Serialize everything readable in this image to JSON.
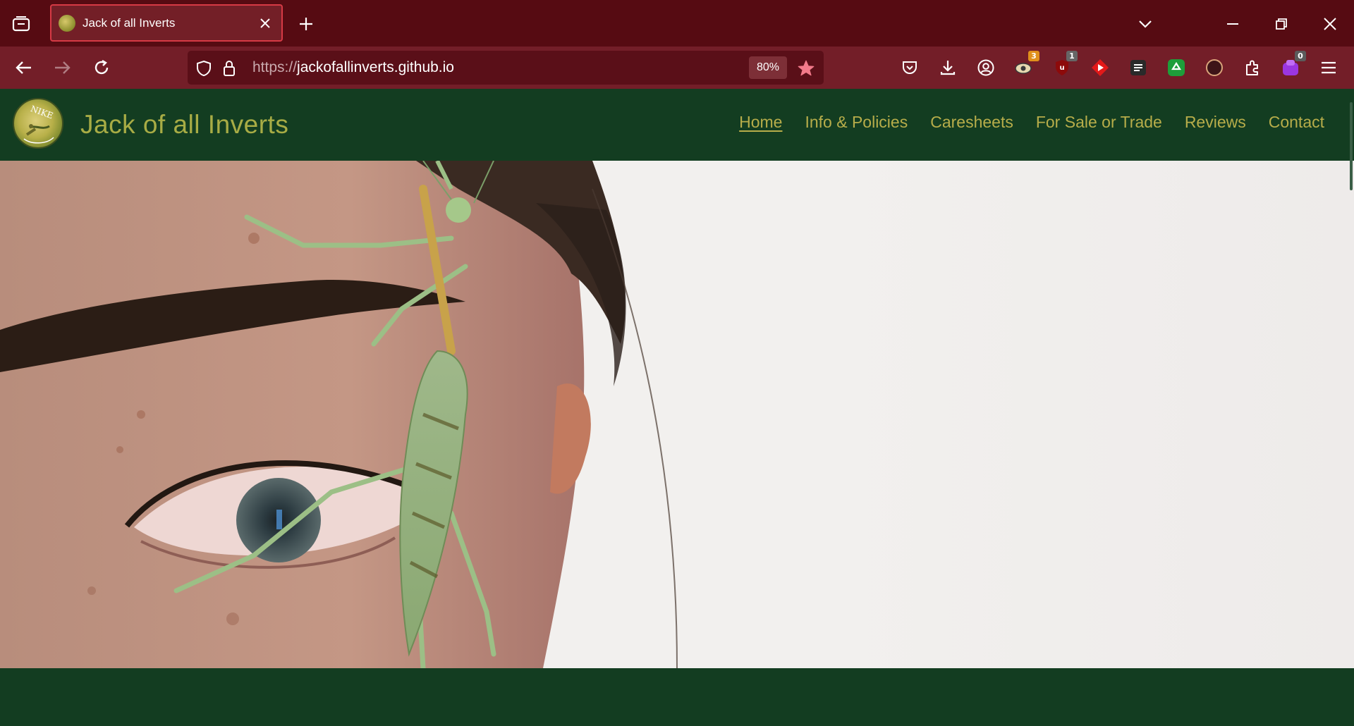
{
  "browser": {
    "tab": {
      "title": "Jack of all Inverts"
    },
    "url": {
      "scheme": "https://",
      "host": "jackofallinverts.github.io"
    },
    "zoom": "80%",
    "extension_badges": {
      "ext1": "3",
      "ublock": "1",
      "ext_purple": "0"
    }
  },
  "site": {
    "title": "Jack of all Inverts",
    "logo_text": "NIKE",
    "nav": [
      {
        "label": "Home",
        "active": true
      },
      {
        "label": "Info & Policies"
      },
      {
        "label": "Caresheets"
      },
      {
        "label": "For Sale or Trade"
      },
      {
        "label": "Reviews"
      },
      {
        "label": "Contact"
      }
    ]
  },
  "colors": {
    "tabbar": "#560b12",
    "navbar": "#731e28",
    "site_header": "#133d21",
    "site_text": "#b7ad4a"
  }
}
